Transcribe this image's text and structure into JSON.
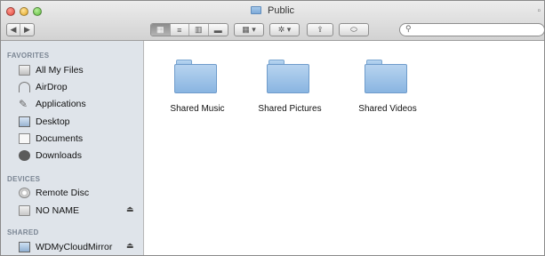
{
  "window": {
    "title": "Public"
  },
  "toolbar": {
    "nav_back_label": "◀",
    "nav_forward_label": "▶",
    "view_icons_label": "▦",
    "view_list_label": "≡",
    "view_columns_label": "▥",
    "view_coverflow_label": "▬",
    "arrange_label": "▦ ▾",
    "action_label": "✲ ▾",
    "share_label": "⇪",
    "tag_label": "⬭",
    "search_placeholder": ""
  },
  "sidebar": {
    "sections": [
      {
        "header": "FAVORITES",
        "items": [
          {
            "label": "All My Files",
            "icon": "all-files-icon"
          },
          {
            "label": "AirDrop",
            "icon": "airdrop-icon"
          },
          {
            "label": "Applications",
            "icon": "applications-icon"
          },
          {
            "label": "Desktop",
            "icon": "desktop-icon"
          },
          {
            "label": "Documents",
            "icon": "documents-icon"
          },
          {
            "label": "Downloads",
            "icon": "downloads-icon"
          }
        ]
      },
      {
        "header": "DEVICES",
        "items": [
          {
            "label": "Remote Disc",
            "icon": "remote-disc-icon"
          },
          {
            "label": "NO NAME",
            "icon": "drive-icon",
            "eject": "⏏"
          }
        ]
      },
      {
        "header": "SHARED",
        "items": [
          {
            "label": "WDMyCloudMirror",
            "icon": "network-share-icon",
            "eject": "⏏"
          }
        ]
      }
    ]
  },
  "content": {
    "items": [
      {
        "label": "Shared Music",
        "icon": "folder-icon"
      },
      {
        "label": "Shared Pictures",
        "icon": "folder-icon"
      },
      {
        "label": "Shared Videos",
        "icon": "folder-icon"
      }
    ]
  }
}
